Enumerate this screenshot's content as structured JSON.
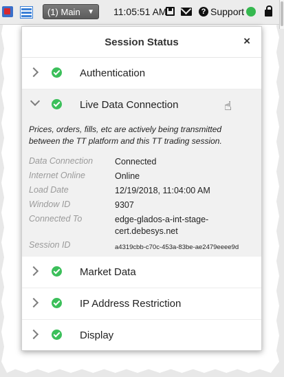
{
  "toolbar": {
    "workspace": "(1) Main",
    "workspace_caret": "▼",
    "time": "11:05:51 AM",
    "support_label": "Support",
    "help_glyph": "?",
    "status_color": "#35b84f",
    "icons": [
      "app-icon",
      "grid-icon",
      "save-icon",
      "mail-icon",
      "help-icon",
      "status-dot",
      "lock-icon"
    ]
  },
  "dialog": {
    "title": "Session Status",
    "close_glyph": "×",
    "rows": [
      {
        "label": "Authentication",
        "expanded": false
      },
      {
        "label": "Live Data Connection",
        "expanded": true
      },
      {
        "label": "Market Data",
        "expanded": false
      },
      {
        "label": "IP Address Restriction",
        "expanded": false
      },
      {
        "label": "Display",
        "expanded": false
      }
    ],
    "live": {
      "description": "Prices, orders, fills, etc are actively being transmitted between the TT platform and this TT trading session.",
      "details": [
        {
          "key": "Data Connection",
          "value": "Connected"
        },
        {
          "key": "Internet Online",
          "value": "Online"
        },
        {
          "key": "Load Date",
          "value": "12/19/2018, 11:04:00 AM"
        },
        {
          "key": "Window ID",
          "value": "9307"
        },
        {
          "key": "Connected To",
          "value": "edge-glados-a-int-stage-cert.debesys.net"
        },
        {
          "key": "Session ID",
          "value": "a4319cbb-c70c-453a-83be-ae2479eeee9d"
        }
      ]
    },
    "status_color": "#3bbf5a"
  }
}
